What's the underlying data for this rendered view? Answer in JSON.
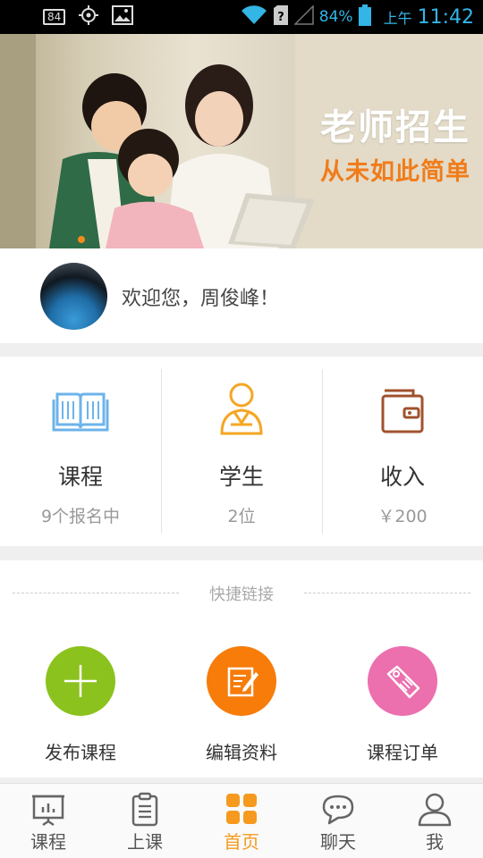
{
  "status_bar": {
    "sim_badge": "84",
    "battery_percent": "84%",
    "ampm": "上午",
    "time": "11:42"
  },
  "banner": {
    "headline": "老师招生",
    "tagline": "从未如此简单",
    "colors": {
      "headline": "#ffffff",
      "tagline": "#f07c1a",
      "active_dot": "#f08b1c"
    }
  },
  "welcome": {
    "text": "欢迎您，周俊峰！"
  },
  "stats": [
    {
      "title": "课程",
      "subtitle": "9个报名中",
      "icon": "book-icon",
      "color": "#6db3ea"
    },
    {
      "title": "学生",
      "subtitle": "2位",
      "icon": "student-icon",
      "color": "#f5a623"
    },
    {
      "title": "收入",
      "subtitle": "￥200",
      "icon": "wallet-icon",
      "color": "#a0522d"
    }
  ],
  "quick_links": {
    "title": "快捷链接",
    "items": [
      {
        "label": "发布课程",
        "icon": "plus-icon",
        "color": "#8cc21e"
      },
      {
        "label": "编辑资料",
        "icon": "edit-icon",
        "color": "#f77c0a"
      },
      {
        "label": "课程订单",
        "icon": "tag-icon",
        "color": "#ec6fae"
      }
    ]
  },
  "bottom_nav": {
    "active_color": "#f59a1e",
    "items": [
      {
        "label": "课程",
        "icon": "presentation-icon",
        "active": false
      },
      {
        "label": "上课",
        "icon": "clipboard-icon",
        "active": false
      },
      {
        "label": "首页",
        "icon": "home-grid-icon",
        "active": true
      },
      {
        "label": "聊天",
        "icon": "chat-icon",
        "active": false
      },
      {
        "label": "我",
        "icon": "person-icon",
        "active": false
      }
    ]
  }
}
